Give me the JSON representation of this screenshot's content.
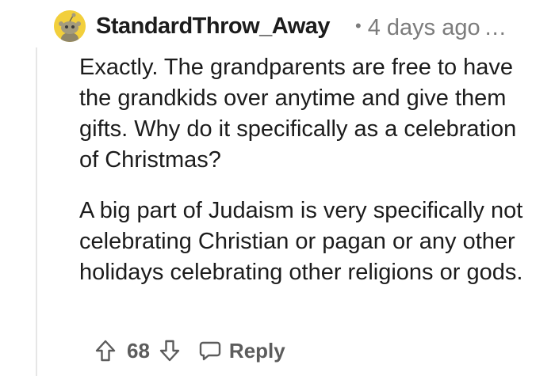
{
  "comment": {
    "author": "StandardThrow_Away",
    "separator": "•",
    "timestamp": "4 days ago",
    "more": "...",
    "paragraphs": [
      "Exactly. The grandparents are free to have the grandkids over anytime and give them gifts. Why do it specifically as a celebration of Christmas?",
      "A big part of Judaism is very specifically not celebrating Christian or pagan or any other holidays celebrating other religions or gods."
    ],
    "score": "68",
    "reply_label": "Reply"
  },
  "icons": {
    "avatar": "snoo-avatar",
    "upvote": "upvote-arrow-icon",
    "downvote": "downvote-arrow-icon",
    "reply": "speech-bubble-icon"
  },
  "colors": {
    "avatar_bg": "#f2cf3c",
    "text": "#1c1c1c",
    "meta": "#7c7c7c",
    "thread_line": "#e6e6e6"
  }
}
